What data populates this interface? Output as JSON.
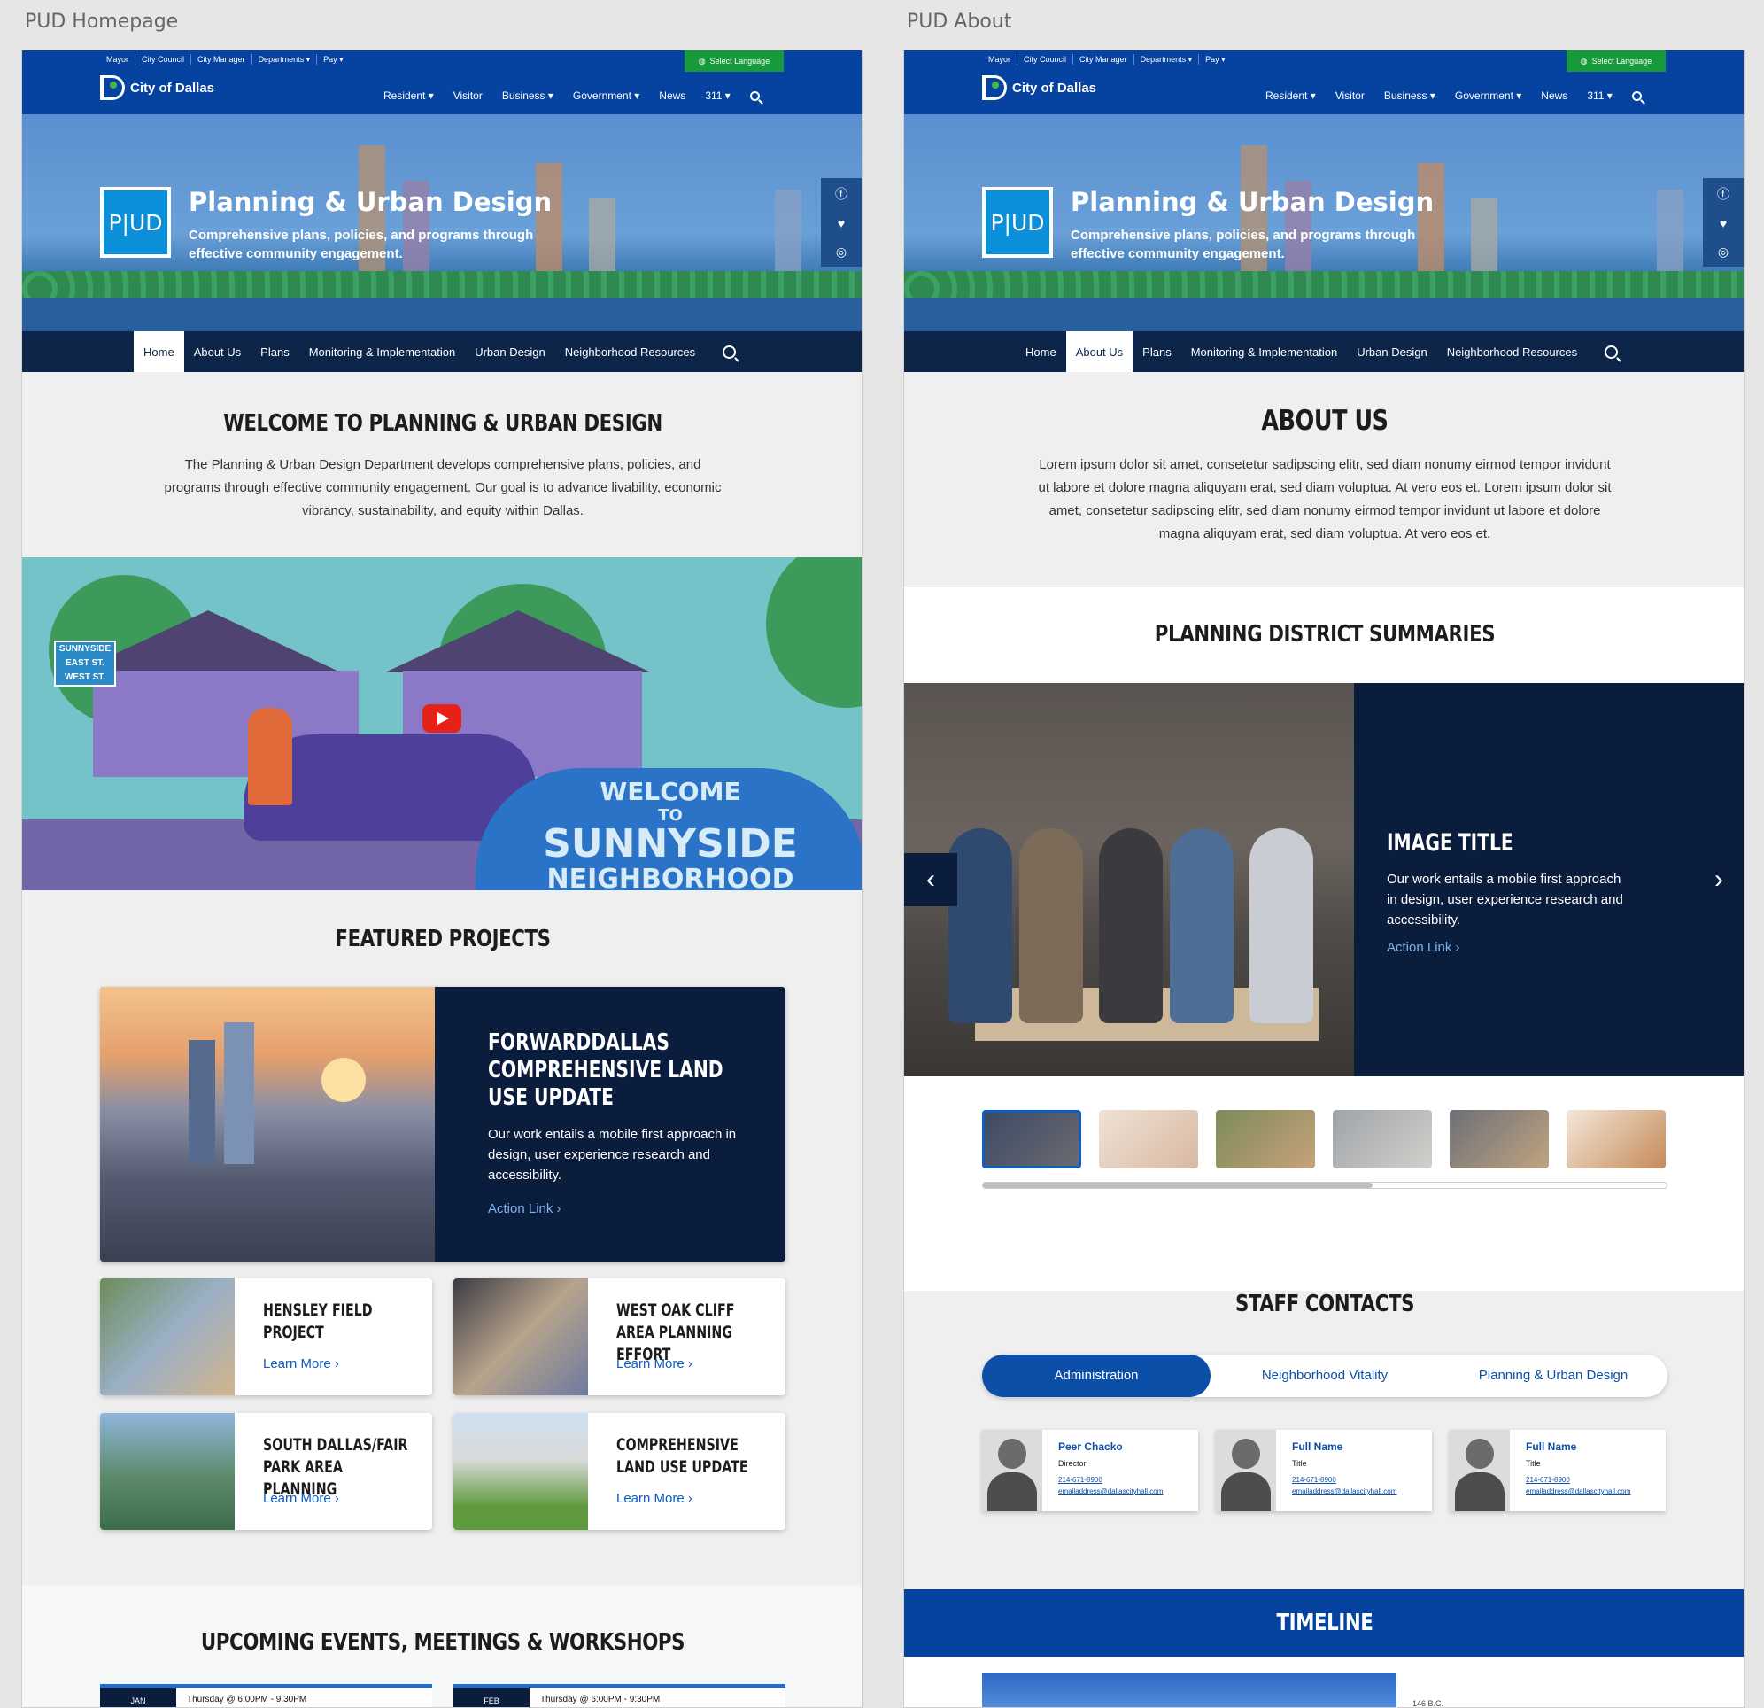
{
  "boards": {
    "left": "PUD Homepage",
    "right": "PUD About"
  },
  "header": {
    "util_links": [
      "Mayor",
      "City Council",
      "City Manager",
      "Departments ▾",
      "Pay ▾"
    ],
    "language_button": "Select Language",
    "logo_text": "City of Dallas",
    "nav": [
      "Resident ▾",
      "Visitor",
      "Business ▾",
      "Government ▾",
      "News",
      "311 ▾"
    ]
  },
  "hero": {
    "badge": "P|UD",
    "title": "Planning & Urban Design",
    "subtitle": "Comprehensive plans, policies, and programs through effective community engagement.",
    "social": [
      "facebook-icon",
      "twitter-icon",
      "instagram-icon"
    ]
  },
  "subnav": {
    "items": [
      "Home",
      "About Us",
      "Plans",
      "Monitoring & Implementation",
      "Urban Design",
      "Neighborhood Resources"
    ],
    "home_active": "Home",
    "about_active": "About Us"
  },
  "home": {
    "welcome_title": "WELCOME TO PLANNING & URBAN DESIGN",
    "welcome_text": "The Planning & Urban Design Department develops comprehensive plans, policies, and programs through effective community engagement. Our goal is to advance livability, economic vibrancy, sustainability, and equity within Dallas.",
    "video": {
      "street_sign_top": "SUNNYSIDE",
      "street_sign_1": "EAST ST.",
      "street_sign_2": "WEST ST.",
      "sign_line1": "WELCOME",
      "sign_line2": "TO",
      "sign_line3": "SUNNYSIDE",
      "sign_line4": "NEIGHBORHOOD"
    },
    "featured_title": "FEATURED PROJECTS",
    "featured": {
      "title": "FORWARDDALLAS COMPREHENSIVE LAND USE UPDATE",
      "desc": "Our work entails a mobile first approach in design, user experience research and accessibility.",
      "link": "Action Link ›"
    },
    "cards": [
      {
        "title": "HENSLEY FIELD PROJECT",
        "link": "Learn More ›"
      },
      {
        "title": "WEST OAK CLIFF AREA PLANNING EFFORT",
        "link": "Learn More ›"
      },
      {
        "title": "SOUTH DALLAS/FAIR PARK AREA PLANNING",
        "link": "Learn More ›"
      },
      {
        "title": "COMPREHENSIVE LAND USE UPDATE",
        "link": "Learn More ›"
      }
    ],
    "events_title": "UPCOMING EVENTS, MEETINGS & WORKSHOPS",
    "events": [
      {
        "month": "JAN",
        "time": "Thursday @  6:00PM - 9:30PM"
      },
      {
        "month": "FEB",
        "time": "Thursday @  6:00PM - 9:30PM"
      }
    ]
  },
  "about": {
    "title": "ABOUT US",
    "text": "Lorem ipsum dolor sit amet, consetetur sadipscing elitr, sed diam nonumy eirmod tempor invidunt ut labore et dolore magna aliquyam erat, sed diam voluptua. At vero eos et. Lorem ipsum dolor sit amet, consetetur sadipscing elitr, sed diam nonumy eirmod tempor invidunt ut labore et dolore magna aliquyam erat, sed diam voluptua. At vero eos et.",
    "district_title": "PLANNING DISTRICT SUMMARIES",
    "carousel": {
      "title": "IMAGE TITLE",
      "desc": "Our work entails a mobile first approach in design, user experience research and accessibility.",
      "link": "Action Link ›",
      "scroll_position": 0.57
    },
    "staff_title": "STAFF CONTACTS",
    "tabs": [
      "Administration",
      "Neighborhood Vitality",
      "Planning & Urban Design"
    ],
    "staff": [
      {
        "name": "Peer Chacko",
        "title": "Director",
        "phone": "214-671-8900",
        "email": "emailaddress@dallascityhall.com"
      },
      {
        "name": "Full Name",
        "title": "Title",
        "phone": "214-671-8900",
        "email": "emailaddress@dallascityhall.com"
      },
      {
        "name": "Full Name",
        "title": "Title",
        "phone": "214-671-8900",
        "email": "emailaddress@dallascityhall.com"
      }
    ],
    "timeline_title": "TIMELINE",
    "timeline_first": "146 B.C."
  }
}
